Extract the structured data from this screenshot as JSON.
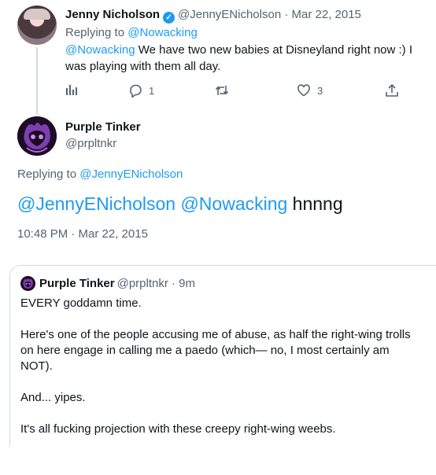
{
  "tweet1": {
    "name": "Jenny Nicholson",
    "handle": "@JennyENicholson",
    "date": "· Mar 22, 2015",
    "replying_prefix": "Replying to",
    "replying_to": "@Nowacking",
    "mention": "@Nowacking",
    "text": " We have two new babies at Disneyland right now :) I was playing with them all day.",
    "reply_count": "1",
    "like_count": "3"
  },
  "tweet2": {
    "name": "Purple Tinker",
    "handle": "@prpltnkr",
    "replying_prefix": "Replying to",
    "replying_to": "@JennyENicholson",
    "mention1": "@JennyENicholson",
    "mention2": "@Nowacking",
    "text": " hnnng",
    "timestamp": "10:48 PM · Mar 22, 2015"
  },
  "quote": {
    "name": "Purple Tinker",
    "handle": "@prpltnkr",
    "time": "· 9m",
    "text": "EVERY goddamn time.\n\nHere's one of the people accusing me of abuse, as half the right-wing trolls on here engage in calling me a paedo (which— no, I most certainly am NOT).\n\nAnd... yipes.\n\nIt's all fucking projection with these creepy right-wing weebs."
  },
  "colors": {
    "accent": "#1d9bf0",
    "secondary_text": "#536471",
    "border": "#cfd9de"
  },
  "icons": [
    "verified-icon",
    "analytics-icon",
    "reply-icon",
    "retweet-icon",
    "like-icon",
    "share-icon"
  ]
}
